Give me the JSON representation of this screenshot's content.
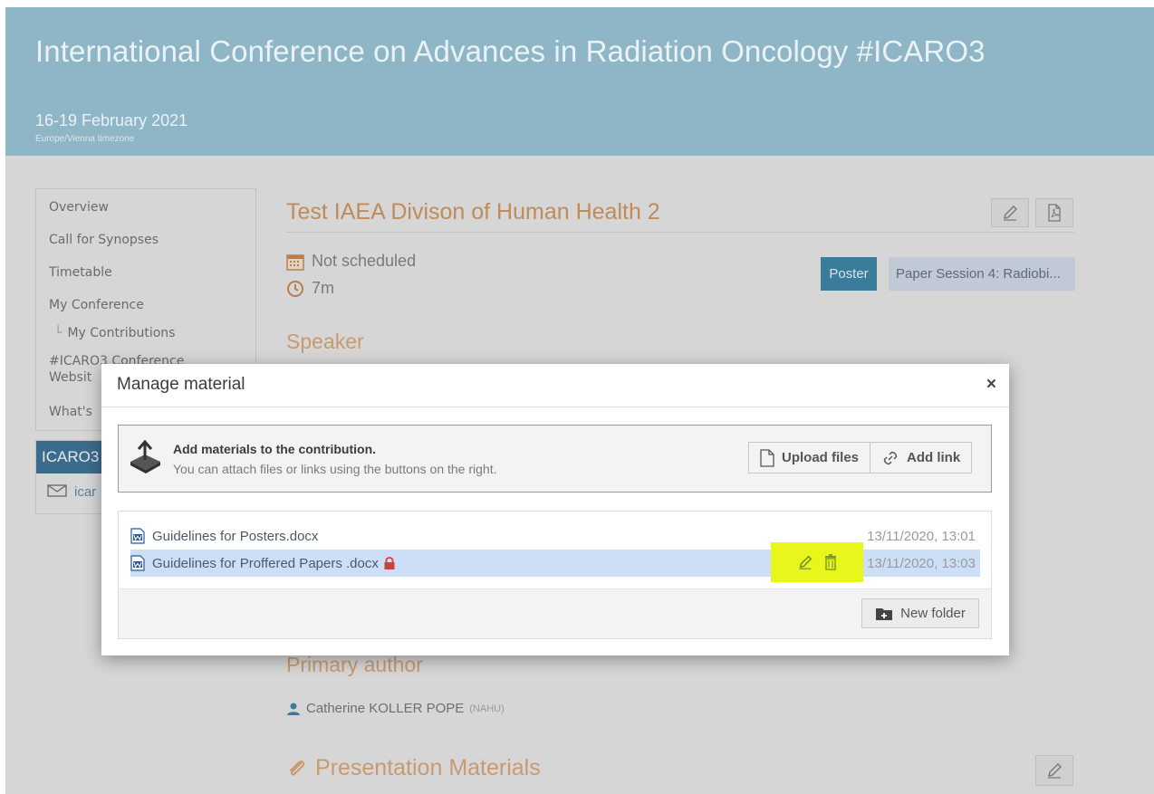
{
  "conference": {
    "title": "International Conference on Advances in Radiation Oncology #ICARO3",
    "dates": "16-19 February 2021",
    "timezone": "Europe/Vienna timezone"
  },
  "sidebar": {
    "items": [
      {
        "label": "Overview"
      },
      {
        "label": "Call for Synopses"
      },
      {
        "label": "Timetable"
      },
      {
        "label": "My Conference"
      },
      {
        "label": "My Contributions",
        "glyph": "└"
      },
      {
        "label": "#ICARO3 Conference"
      },
      {
        "label": "Websit"
      },
      {
        "label": "What's"
      }
    ],
    "contact_box": {
      "title": "ICARO3",
      "email_partial": "icar"
    }
  },
  "contribution": {
    "title": "Test IAEA Divison of Human Health 2",
    "schedule": "Not scheduled",
    "duration": "7m",
    "type_tag": "Poster",
    "session_tag": "Paper Session 4: Radiobi...",
    "speaker_heading": "Speaker",
    "primary_author_heading": "Primary author",
    "author_name": "Catherine KOLLER POPE",
    "author_affiliation": "(NAHU)",
    "materials_heading": "Presentation Materials"
  },
  "modal": {
    "title": "Manage material",
    "close_glyph": "×",
    "add": {
      "title": "Add materials to the contribution.",
      "description": "You can attach files or links using the buttons on the right.",
      "upload_label": "Upload files",
      "link_label": "Add link"
    },
    "files": [
      {
        "name": "Guidelines for Posters.docx",
        "date": "13/11/2020, 13:01",
        "locked": false,
        "selected": false
      },
      {
        "name": "Guidelines for Proffered Papers .docx",
        "date": "13/11/2020, 13:03",
        "locked": true,
        "selected": true
      }
    ],
    "new_folder_label": "New folder"
  },
  "colors": {
    "header_bg": "#8fb6c6",
    "title_accent": "#bf8b5b",
    "poster_tag": "#3a7c99",
    "selected_row": "#cddff7",
    "highlight": "#e8f61b"
  },
  "icons": {
    "calendar": "calendar-icon",
    "clock": "clock-icon",
    "edit": "pencil-icon",
    "pdf": "pdf-icon",
    "upload": "upload-icon",
    "file": "file-icon",
    "link": "link-icon",
    "word": "word-doc-icon",
    "lock": "lock-icon",
    "trash": "trash-icon",
    "folder_add": "folder-add-icon",
    "user": "user-icon",
    "paperclip": "paperclip-icon",
    "mail": "mail-icon"
  }
}
